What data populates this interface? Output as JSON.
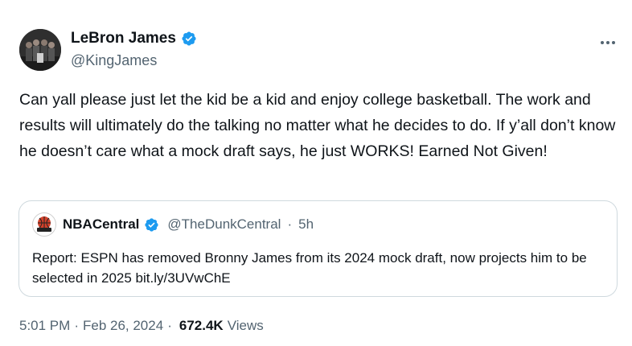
{
  "author": {
    "display_name": "LeBron James",
    "handle": "@KingJames"
  },
  "more_icon": "more-horizontal-icon",
  "tweet": {
    "text": "Can yall please just let the kid be a kid and enjoy college basketball. The work and results will ultimately do the talking no matter what he decides to do. If y’all don’t know he doesn’t care what a mock draft says, he just WORKS! Earned Not Given!"
  },
  "quote": {
    "display_name": "NBACentral",
    "handle": "@TheDunkCentral",
    "separator": "·",
    "time": "5h",
    "text": "Report: ESPN has removed Bronny James from its 2024 mock draft, now projects him to be selected in 2025 bit.ly/3UVwChE"
  },
  "meta": {
    "time": "5:01 PM",
    "separator": "·",
    "date": "Feb 26, 2024",
    "views_count": "672.4K",
    "views_label": "Views"
  },
  "colors": {
    "verified": "#1d9bf0",
    "secondary_text": "#536471",
    "primary_text": "#0f1419",
    "border": "#cfd9de"
  }
}
